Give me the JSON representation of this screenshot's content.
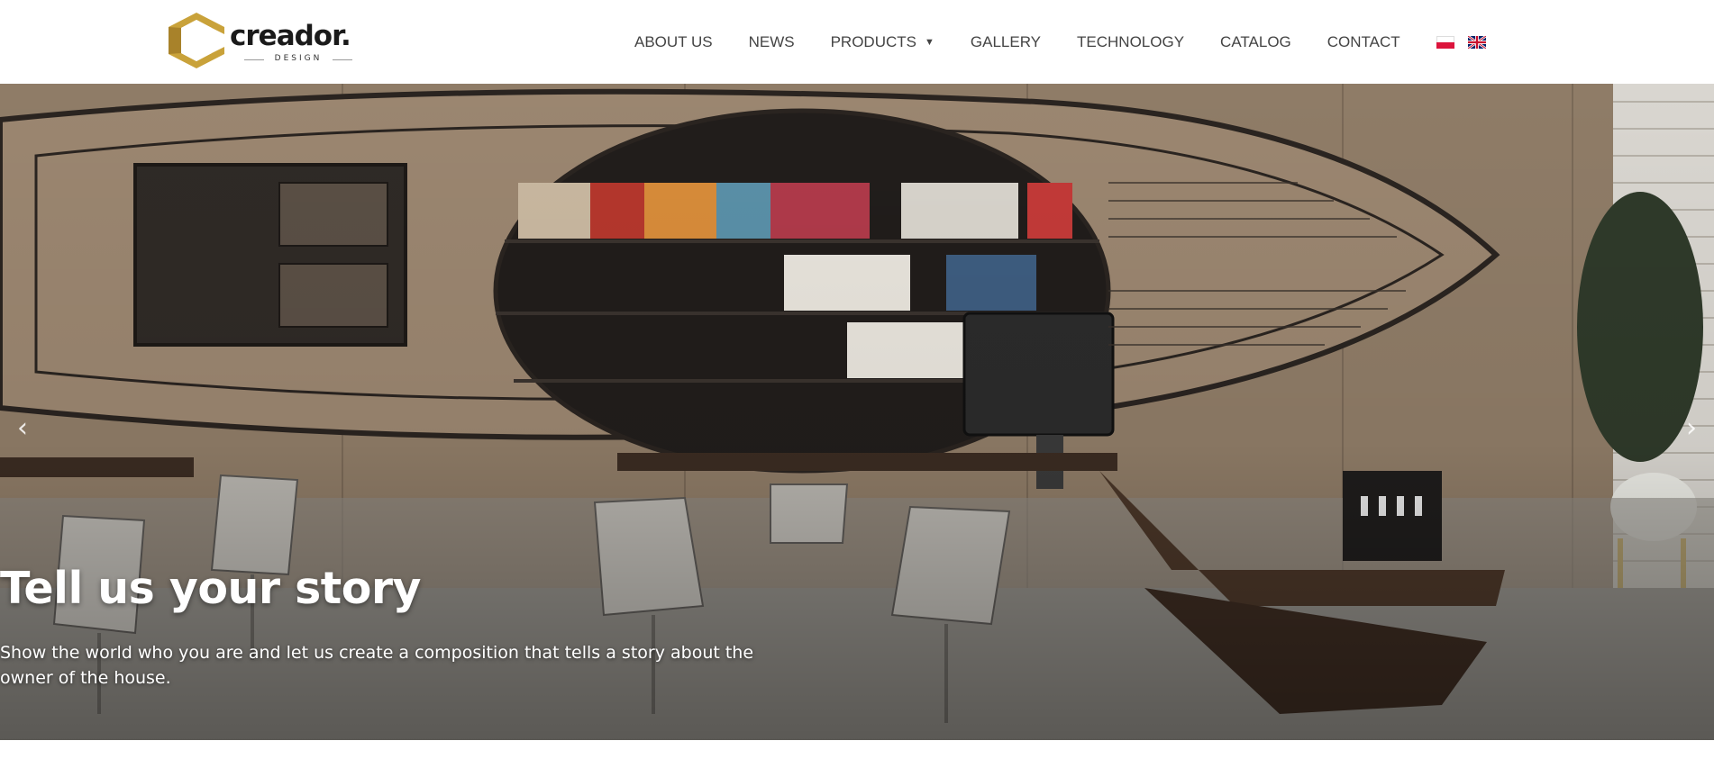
{
  "brand": {
    "name": "creador.",
    "tagline": "DESIGN",
    "gold": "#c9a23a",
    "logo_icon": "hexagon-c-logo"
  },
  "nav": {
    "items": [
      {
        "label": "ABOUT US"
      },
      {
        "label": "NEWS"
      },
      {
        "label": "PRODUCTS",
        "has_dropdown": true
      },
      {
        "label": "GALLERY"
      },
      {
        "label": "TECHNOLOGY"
      },
      {
        "label": "CATALOG"
      },
      {
        "label": "CONTACT"
      }
    ],
    "languages": [
      {
        "code": "pl",
        "icon": "poland-flag-icon"
      },
      {
        "code": "en",
        "icon": "uk-flag-icon"
      }
    ],
    "text_color": "#444444"
  },
  "hero": {
    "title": "Tell us your story",
    "text": "Show the world who you are and let us create a composition that tells a story about the owner of the house.",
    "prev_icon": "chevron-left-icon",
    "next_icon": "chevron-right-icon",
    "prev_glyph": "‹",
    "next_glyph": "›"
  }
}
